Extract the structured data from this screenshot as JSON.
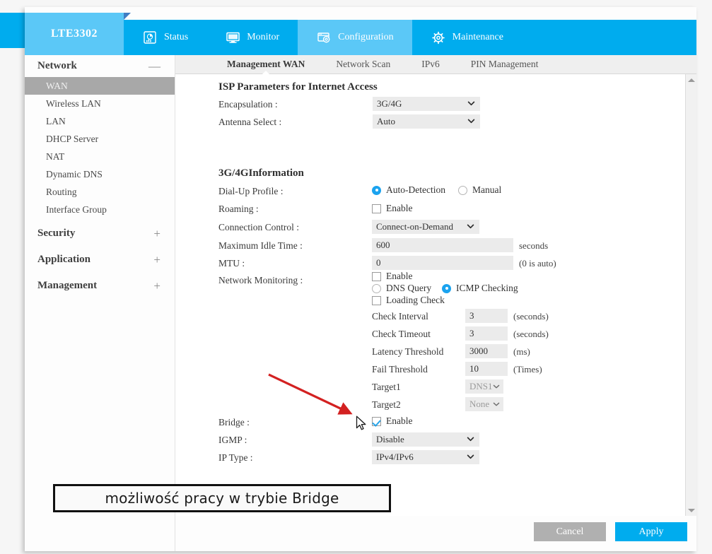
{
  "device": {
    "model": "LTE3302"
  },
  "topnav": [
    {
      "label": "Status",
      "icon": "status-chart-icon",
      "active": false
    },
    {
      "label": "Monitor",
      "icon": "monitor-screen-icon",
      "active": false
    },
    {
      "label": "Configuration",
      "icon": "configuration-window-gear-icon",
      "active": true
    },
    {
      "label": "Maintenance",
      "icon": "gear-icon",
      "active": false
    }
  ],
  "subnav": [
    {
      "label": "Management WAN",
      "active": true
    },
    {
      "label": "Network Scan",
      "active": false
    },
    {
      "label": "IPv6",
      "active": false
    },
    {
      "label": "PIN Management",
      "active": false
    }
  ],
  "sidebar": {
    "groups": [
      {
        "title": "Network",
        "sign": "—",
        "items": [
          {
            "label": "WAN",
            "active": true
          },
          {
            "label": "Wireless LAN",
            "active": false
          },
          {
            "label": "LAN",
            "active": false
          },
          {
            "label": "DHCP Server",
            "active": false
          },
          {
            "label": "NAT",
            "active": false
          },
          {
            "label": "Dynamic DNS",
            "active": false
          },
          {
            "label": "Routing",
            "active": false
          },
          {
            "label": "Interface Group",
            "active": false
          }
        ]
      },
      {
        "title": "Security",
        "sign": "+",
        "items": []
      },
      {
        "title": "Application",
        "sign": "+",
        "items": []
      },
      {
        "title": "Management",
        "sign": "+",
        "items": []
      }
    ]
  },
  "main": {
    "isp_section_title": "ISP Parameters for Internet Access",
    "encapsulation_label": "Encapsulation :",
    "encapsulation_value": "3G/4G",
    "antenna_label": "Antenna Select :",
    "antenna_value": "Auto",
    "info_section_title": "3G/4GInformation",
    "dialup_label": "Dial-Up Profile :",
    "dialup_auto": "Auto-Detection",
    "dialup_manual": "Manual",
    "roaming_label": "Roaming :",
    "roaming_enable": "Enable",
    "conn_control_label": "Connection Control :",
    "conn_control_value": "Connect-on-Demand",
    "max_idle_label": "Maximum Idle Time :",
    "max_idle_value": "600",
    "max_idle_unit": "seconds",
    "mtu_label": "MTU :",
    "mtu_value": "0",
    "mtu_unit": "(0 is auto)",
    "netmon_label": "Network Monitoring :",
    "netmon_enable": "Enable",
    "netmon_dns_query": "DNS Query",
    "netmon_icmp": "ICMP Checking",
    "netmon_loading": "Loading Check",
    "check_interval_label": "Check Interval",
    "check_interval_value": "3",
    "check_interval_unit": "(seconds)",
    "check_timeout_label": "Check Timeout",
    "check_timeout_value": "3",
    "check_timeout_unit": "(seconds)",
    "latency_label": "Latency Threshold",
    "latency_value": "3000",
    "latency_unit": "(ms)",
    "fail_label": "Fail Threshold",
    "fail_value": "10",
    "fail_unit": "(Times)",
    "target1_label": "Target1",
    "target1_value": "DNS1",
    "target2_label": "Target2",
    "target2_value": "None",
    "bridge_label": "Bridge :",
    "bridge_enable": "Enable",
    "igmp_label": "IGMP :",
    "igmp_value": "Disable",
    "iptype_label": "IP Type :",
    "iptype_value": "IPv4/IPv6"
  },
  "footer": {
    "cancel_label": "Cancel",
    "apply_label": "Apply"
  },
  "annotation": {
    "text": "możliwość pracy w trybie Bridge"
  },
  "colors": {
    "brand_blue": "#00ACEE",
    "brand_blue_light": "#5BC8F7",
    "accent_check": "#27A3E8",
    "sidebar_active": "#A8A8A8",
    "cancel_gray": "#B0B0B0",
    "annotation_arrow": "#D32121",
    "field_bg": "#EBEBEB"
  }
}
